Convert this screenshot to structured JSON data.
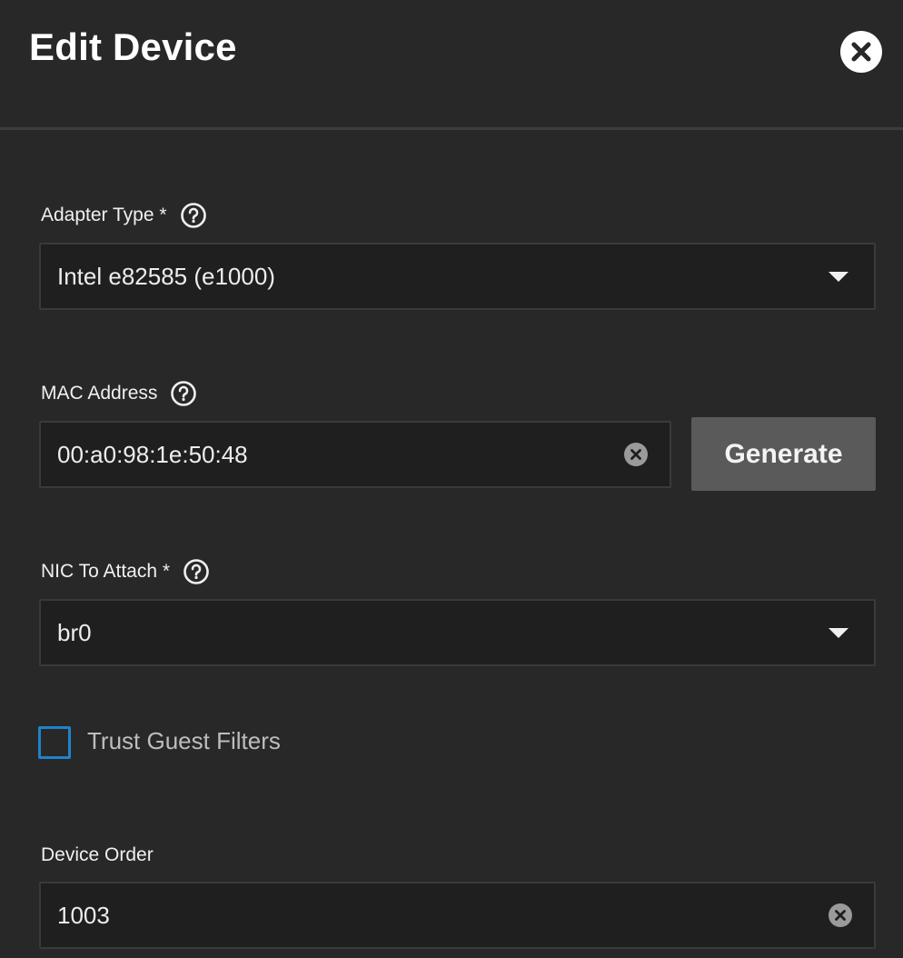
{
  "dialog": {
    "title": "Edit Device",
    "close_icon": "close-icon"
  },
  "fields": {
    "adapter_type": {
      "label": "Adapter Type *",
      "value": "Intel e82585 (e1000)",
      "help_icon": "help-circle-icon",
      "dropdown_icon": "caret-down-icon"
    },
    "mac_address": {
      "label": "MAC Address",
      "value": "00:a0:98:1e:50:48",
      "help_icon": "help-circle-icon",
      "clear_icon": "clear-icon",
      "generate_label": "Generate"
    },
    "nic_to_attach": {
      "label": "NIC To Attach *",
      "value": "br0",
      "help_icon": "help-circle-icon",
      "dropdown_icon": "caret-down-icon"
    },
    "trust_guest_filters": {
      "label": "Trust Guest Filters",
      "checked": false
    },
    "device_order": {
      "label": "Device Order",
      "value": "1003",
      "clear_icon": "clear-icon"
    }
  },
  "colors": {
    "background": "#282828",
    "field_background": "#1f1f1f",
    "field_border": "#3a3a3a",
    "button_background": "#5a5a5a",
    "checkbox_accent": "#1e84c8"
  }
}
